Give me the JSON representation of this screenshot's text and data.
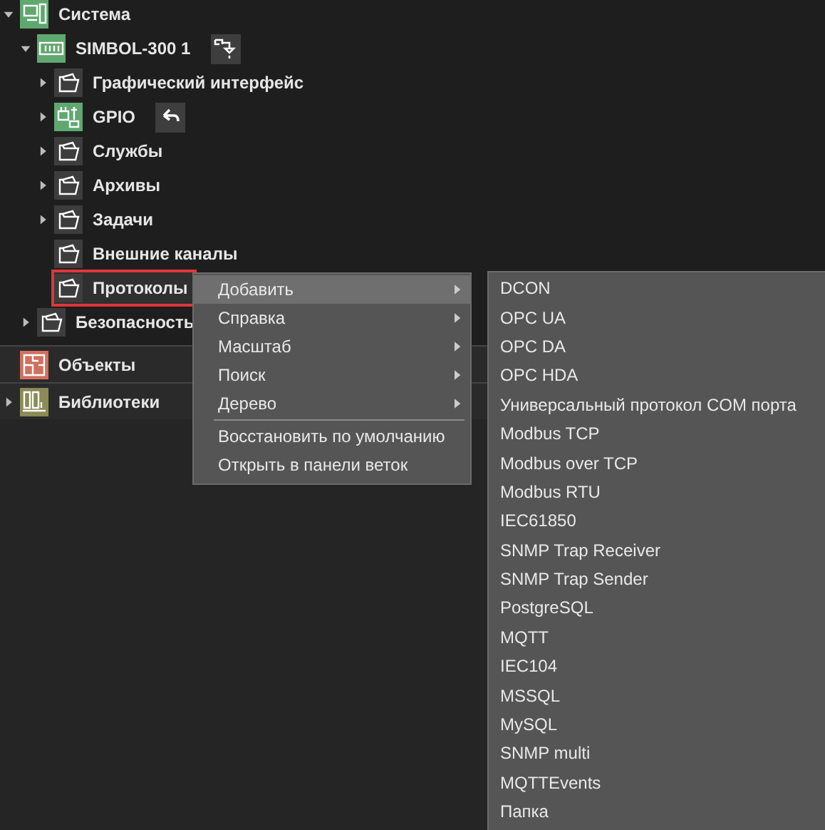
{
  "tree": [
    {
      "label": "Система",
      "kind": "system",
      "has_children": true,
      "expanded": true,
      "selected": false,
      "children": [
        {
          "label": "SIMBOL-300 1",
          "kind": "module",
          "has_children": true,
          "expanded": true,
          "selected": false,
          "action": {
            "kind": "insert"
          },
          "children": [
            {
              "label": "Графический интерфейс",
              "kind": "folder",
              "has_children": true,
              "expanded": false,
              "selected": false
            },
            {
              "label": "GPIO",
              "kind": "gpio",
              "has_children": true,
              "expanded": false,
              "selected": false,
              "action": {
                "kind": "undo"
              }
            },
            {
              "label": "Службы",
              "kind": "folder",
              "has_children": true,
              "expanded": false,
              "selected": false
            },
            {
              "label": "Архивы",
              "kind": "folder",
              "has_children": true,
              "expanded": false,
              "selected": false
            },
            {
              "label": "Задачи",
              "kind": "folder",
              "has_children": true,
              "expanded": false,
              "selected": false
            },
            {
              "label": "Внешние каналы",
              "kind": "folder",
              "has_children": false,
              "selected": false
            },
            {
              "label": "Протоколы",
              "kind": "folder",
              "has_children": false,
              "selected": true
            }
          ]
        },
        {
          "label": "Безопасность",
          "kind": "folder",
          "has_children": true,
          "expanded": false,
          "selected": false
        }
      ]
    }
  ],
  "panels": [
    {
      "label": "Объекты",
      "kind": "objects",
      "has_children": false
    },
    {
      "label": "Библиотеки",
      "kind": "libraries",
      "has_children": true,
      "expanded": false
    }
  ],
  "context_menu": {
    "items": [
      {
        "kind": "item",
        "label": "Добавить",
        "submenu": true,
        "selected": true
      },
      {
        "kind": "item",
        "label": "Справка",
        "submenu": true,
        "selected": false
      },
      {
        "kind": "item",
        "label": "Масштаб",
        "submenu": true,
        "selected": false
      },
      {
        "kind": "item",
        "label": "Поиск",
        "submenu": true,
        "selected": false
      },
      {
        "kind": "item",
        "label": "Дерево",
        "submenu": true,
        "selected": false
      },
      {
        "kind": "separator"
      },
      {
        "kind": "item",
        "label": "Восстановить по умолчанию",
        "submenu": false,
        "selected": false
      },
      {
        "kind": "item",
        "label": "Открыть в панели веток",
        "submenu": false,
        "selected": false
      }
    ]
  },
  "submenu": {
    "items": [
      "DCON",
      "OPC UA",
      "OPC DA",
      "OPC HDA",
      "Универсальный протокол COM порта",
      "Modbus TCP",
      "Modbus over TCP",
      "Modbus RTU",
      "IEC61850",
      "SNMP Trap Receiver",
      "SNMP Trap Sender",
      "PostgreSQL",
      "MQTT",
      "IEC104",
      "MSSQL",
      "MySQL",
      "SNMP multi",
      "MQTTEvents",
      "Папка"
    ]
  }
}
